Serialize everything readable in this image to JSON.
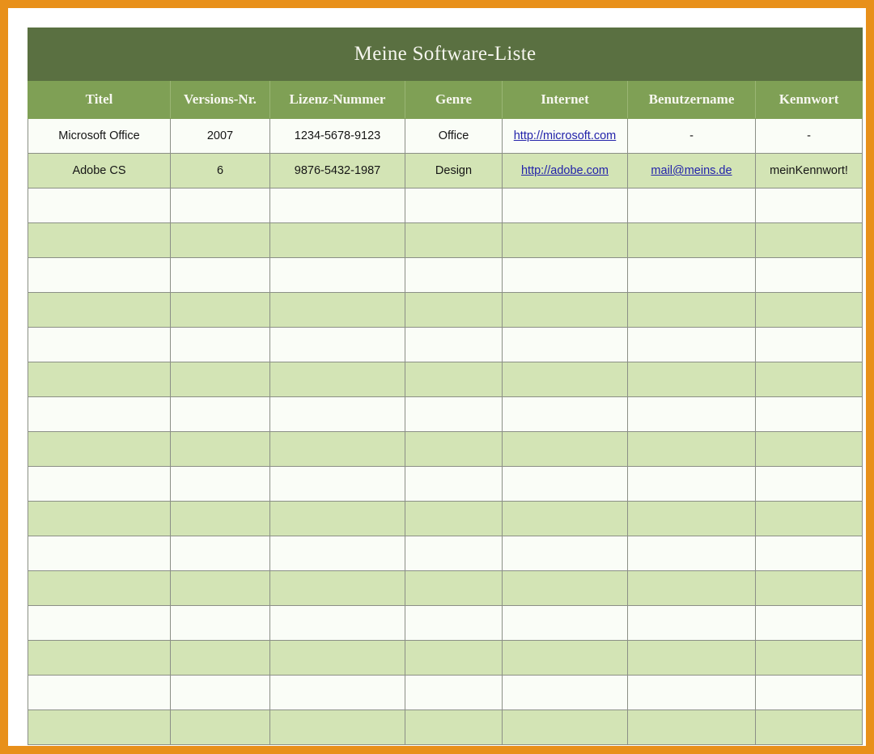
{
  "document": {
    "title": "Meine Software-Liste",
    "accent_border_color": "#e8901a",
    "title_bar_color": "#5a7041",
    "header_row_color": "#7fa055",
    "row_color_odd": "#fafdf7",
    "row_color_even": "#d3e4b5",
    "link_color": "#2222aa"
  },
  "table": {
    "columns": [
      {
        "key": "titel",
        "label": "Titel"
      },
      {
        "key": "version",
        "label": "Versions-Nr."
      },
      {
        "key": "lizenz",
        "label": "Lizenz-Nummer"
      },
      {
        "key": "genre",
        "label": "Genre"
      },
      {
        "key": "internet",
        "label": "Internet"
      },
      {
        "key": "benutzername",
        "label": "Benutzername"
      },
      {
        "key": "kennwort",
        "label": "Kennwort"
      }
    ],
    "total_rows": 18,
    "rows": [
      {
        "titel": "Microsoft Office",
        "version": "2007",
        "lizenz": "1234-5678-9123",
        "genre": "Office",
        "internet": "http://microsoft.com",
        "internet_is_link": true,
        "benutzername": "-",
        "benutzername_is_link": false,
        "kennwort": "-",
        "kennwort_is_link": false
      },
      {
        "titel": "Adobe CS",
        "version": "6",
        "lizenz": "9876-5432-1987",
        "genre": "Design",
        "internet": "http://adobe.com",
        "internet_is_link": true,
        "benutzername": "mail@meins.de",
        "benutzername_is_link": true,
        "kennwort": "meinKennwort!",
        "kennwort_is_link": false
      },
      {
        "titel": "",
        "version": "",
        "lizenz": "",
        "genre": "",
        "internet": "",
        "benutzername": "",
        "kennwort": ""
      },
      {
        "titel": "",
        "version": "",
        "lizenz": "",
        "genre": "",
        "internet": "",
        "benutzername": "",
        "kennwort": ""
      },
      {
        "titel": "",
        "version": "",
        "lizenz": "",
        "genre": "",
        "internet": "",
        "benutzername": "",
        "kennwort": ""
      },
      {
        "titel": "",
        "version": "",
        "lizenz": "",
        "genre": "",
        "internet": "",
        "benutzername": "",
        "kennwort": ""
      },
      {
        "titel": "",
        "version": "",
        "lizenz": "",
        "genre": "",
        "internet": "",
        "benutzername": "",
        "kennwort": ""
      },
      {
        "titel": "",
        "version": "",
        "lizenz": "",
        "genre": "",
        "internet": "",
        "benutzername": "",
        "kennwort": ""
      },
      {
        "titel": "",
        "version": "",
        "lizenz": "",
        "genre": "",
        "internet": "",
        "benutzername": "",
        "kennwort": ""
      },
      {
        "titel": "",
        "version": "",
        "lizenz": "",
        "genre": "",
        "internet": "",
        "benutzername": "",
        "kennwort": ""
      },
      {
        "titel": "",
        "version": "",
        "lizenz": "",
        "genre": "",
        "internet": "",
        "benutzername": "",
        "kennwort": ""
      },
      {
        "titel": "",
        "version": "",
        "lizenz": "",
        "genre": "",
        "internet": "",
        "benutzername": "",
        "kennwort": ""
      },
      {
        "titel": "",
        "version": "",
        "lizenz": "",
        "genre": "",
        "internet": "",
        "benutzername": "",
        "kennwort": ""
      },
      {
        "titel": "",
        "version": "",
        "lizenz": "",
        "genre": "",
        "internet": "",
        "benutzername": "",
        "kennwort": ""
      },
      {
        "titel": "",
        "version": "",
        "lizenz": "",
        "genre": "",
        "internet": "",
        "benutzername": "",
        "kennwort": ""
      },
      {
        "titel": "",
        "version": "",
        "lizenz": "",
        "genre": "",
        "internet": "",
        "benutzername": "",
        "kennwort": ""
      },
      {
        "titel": "",
        "version": "",
        "lizenz": "",
        "genre": "",
        "internet": "",
        "benutzername": "",
        "kennwort": ""
      },
      {
        "titel": "",
        "version": "",
        "lizenz": "",
        "genre": "",
        "internet": "",
        "benutzername": "",
        "kennwort": ""
      }
    ]
  }
}
